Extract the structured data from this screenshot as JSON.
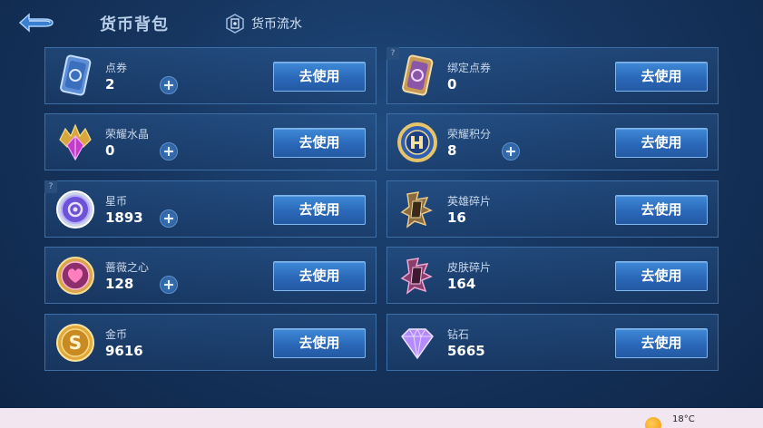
{
  "header": {
    "title": "货币背包",
    "flow_label": "货币流水",
    "back_icon": "back-arrow-icon"
  },
  "currencies": [
    {
      "name": "点券",
      "amount": "2",
      "button": "去使用",
      "icon": "voucher-card-icon",
      "has_plus": true,
      "has_help": false
    },
    {
      "name": "绑定点券",
      "amount": "0",
      "button": "去使用",
      "icon": "bound-voucher-card-icon",
      "has_plus": false,
      "has_help": true
    },
    {
      "name": "荣耀水晶",
      "amount": "0",
      "button": "去使用",
      "icon": "glory-crystal-icon",
      "has_plus": true,
      "has_help": false
    },
    {
      "name": "荣耀积分",
      "amount": "8",
      "button": "去使用",
      "icon": "glory-points-icon",
      "has_plus": true,
      "has_help": false
    },
    {
      "name": "星币",
      "amount": "1893",
      "button": "去使用",
      "icon": "star-coin-icon",
      "has_plus": true,
      "has_help": true
    },
    {
      "name": "英雄碎片",
      "amount": "16",
      "button": "去使用",
      "icon": "hero-fragment-icon",
      "has_plus": false,
      "has_help": false
    },
    {
      "name": "蔷薇之心",
      "amount": "128",
      "button": "去使用",
      "icon": "rose-heart-icon",
      "has_plus": true,
      "has_help": false
    },
    {
      "name": "皮肤碎片",
      "amount": "164",
      "button": "去使用",
      "icon": "skin-fragment-icon",
      "has_plus": false,
      "has_help": false
    },
    {
      "name": "金币",
      "amount": "9616",
      "button": "去使用",
      "icon": "gold-coin-icon",
      "has_plus": false,
      "has_help": false
    },
    {
      "name": "钻石",
      "amount": "5665",
      "button": "去使用",
      "icon": "diamond-icon",
      "has_plus": false,
      "has_help": false
    }
  ],
  "taskbar": {
    "temperature": "18°C",
    "weather_icon": "sun-icon"
  }
}
